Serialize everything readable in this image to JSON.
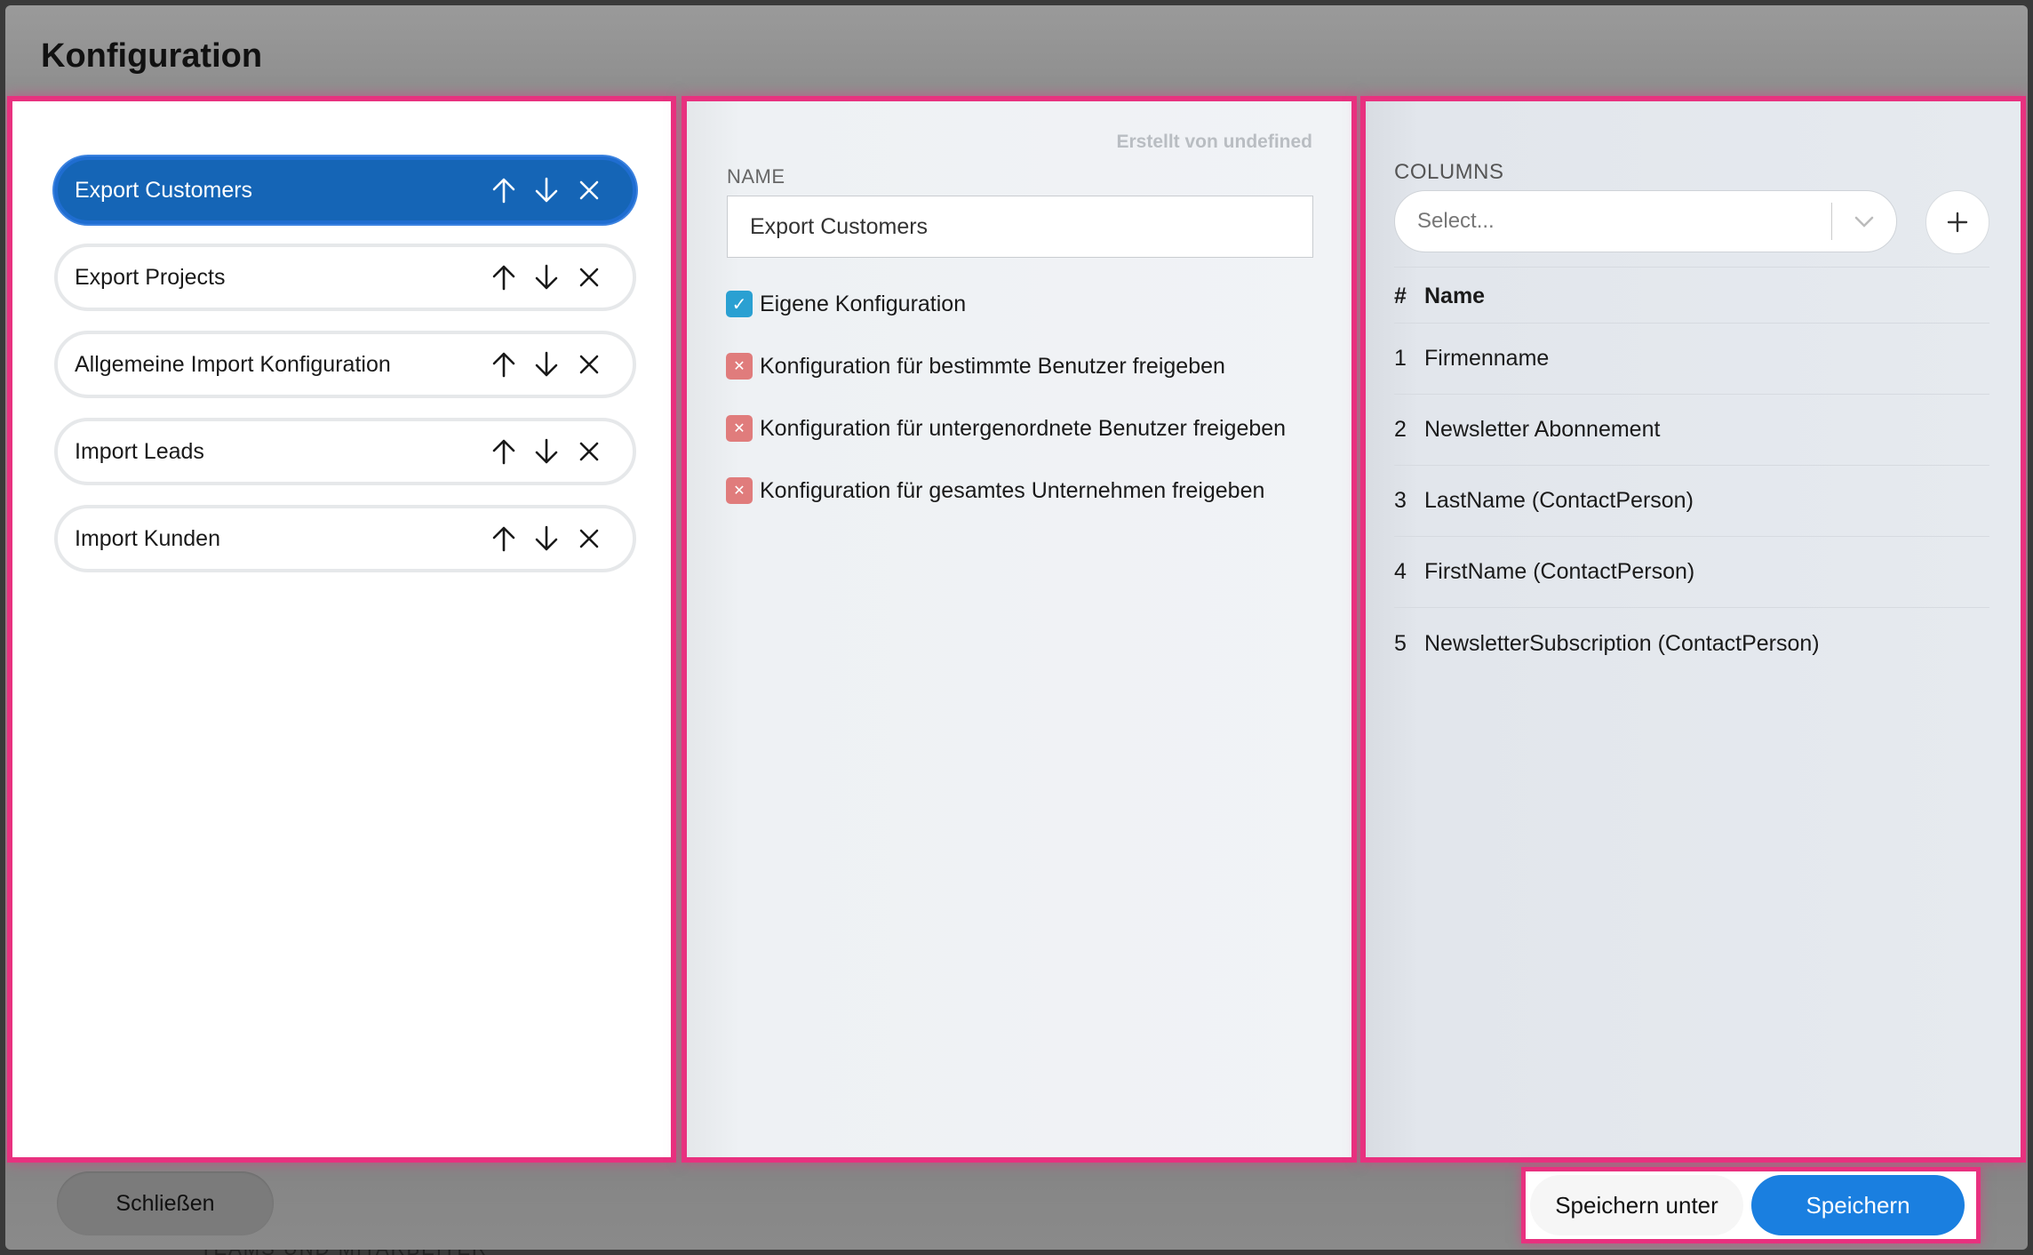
{
  "dialog": {
    "title": "Konfiguration"
  },
  "configurations": [
    {
      "label": "Export Customers",
      "active": true
    },
    {
      "label": "Export Projects",
      "active": false
    },
    {
      "label": "Allgemeine Import Konfiguration",
      "active": false
    },
    {
      "label": "Import Leads",
      "active": false
    },
    {
      "label": "Import Kunden",
      "active": false
    }
  ],
  "item_actions": {
    "move_up_icon": "arrow-up-icon",
    "move_down_icon": "arrow-down-icon",
    "delete_icon": "close-icon"
  },
  "details": {
    "created_by": "Erstellt von undefined",
    "name_label": "NAME",
    "name_value": "Export Customers",
    "options": [
      {
        "label": "Eigene Konfiguration",
        "checked": true
      },
      {
        "label": "Konfiguration für bestimmte Benutzer freigeben",
        "checked": false
      },
      {
        "label": "Konfiguration für untergenordnete Benutzer freigeben",
        "checked": false
      },
      {
        "label": "Konfiguration für gesamtes Unternehmen freigeben",
        "checked": false
      }
    ]
  },
  "columns": {
    "label": "COLUMNS",
    "select_placeholder": "Select...",
    "add_icon": "plus-icon",
    "table_header": {
      "num": "#",
      "name": "Name"
    },
    "rows": [
      {
        "num": "1",
        "name": "Firmenname"
      },
      {
        "num": "2",
        "name": "Newsletter Abonnement"
      },
      {
        "num": "3",
        "name": "LastName (ContactPerson)"
      },
      {
        "num": "4",
        "name": "FirstName (ContactPerson)"
      },
      {
        "num": "5",
        "name": "NewsletterSubscription (ContactPerson)"
      }
    ]
  },
  "footer": {
    "close_label": "Schließen",
    "save_as_label": "Speichern unter",
    "save_label": "Speichern"
  },
  "colors": {
    "accent": "#1a7fe0",
    "active_item": "#1565b6",
    "highlight": "#e8317f",
    "checkbox_on": "#2aa0d2",
    "checkbox_off": "#e07c7c"
  }
}
